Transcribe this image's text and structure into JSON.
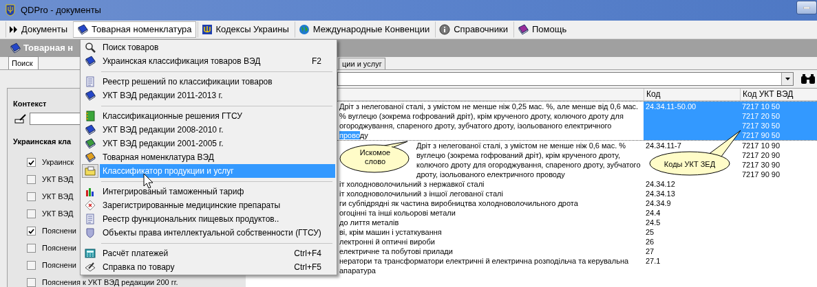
{
  "window": {
    "title": "QDPro - документы"
  },
  "menu_bar": [
    {
      "label": "Документы",
      "selected": false
    },
    {
      "label": "Товарная номенклатура",
      "selected": true
    },
    {
      "label": "Кодексы Украины",
      "selected": false
    },
    {
      "label": "Международные Конвенции",
      "selected": false
    },
    {
      "label": "Справочники",
      "selected": false
    },
    {
      "label": "Помощь",
      "selected": false
    }
  ],
  "section_header": "Товарная н",
  "tabs": [
    {
      "label": "Поиск",
      "selected": true
    },
    {
      "label": "ции и услуг",
      "selected": false
    }
  ],
  "search_panel": {
    "context_label": "Контекст",
    "group_label": "Украинская кла",
    "sources": [
      {
        "label": "Украинск",
        "checked": true
      },
      {
        "label": "УКТ ВЭД",
        "checked": false
      },
      {
        "label": "УКТ ВЭД",
        "checked": false
      },
      {
        "label": "УКТ ВЭД",
        "checked": false
      },
      {
        "label": "Пояснени",
        "checked": true
      },
      {
        "label": "Пояснени",
        "checked": false
      },
      {
        "label": "Пояснени",
        "checked": false
      },
      {
        "label": "Пояснения к УКТ ВЭД редакции 200 гг.",
        "checked": false
      }
    ]
  },
  "dropdown_menu": [
    {
      "kind": "item",
      "label": "Поиск товаров",
      "selected": false
    },
    {
      "kind": "item",
      "label": "Украинская классификация товаров ВЭД",
      "shortcut": "F2",
      "selected": false
    },
    {
      "kind": "separator"
    },
    {
      "kind": "item",
      "label": "Реестр решений по классификации товаров",
      "selected": false
    },
    {
      "kind": "item",
      "label": "УКТ ВЭД редакции 2011-2013 г.",
      "selected": false
    },
    {
      "kind": "separator"
    },
    {
      "kind": "item",
      "label": "Классификационные решения ГТСУ",
      "selected": false
    },
    {
      "kind": "item",
      "label": "УКТ ВЭД редакции 2008-2010 г.",
      "selected": false
    },
    {
      "kind": "item",
      "label": "УКТ ВЭД редакции 2001-2005 г.",
      "selected": false
    },
    {
      "kind": "item",
      "label": "Товарная номенклатура ВЭД",
      "selected": false
    },
    {
      "kind": "item",
      "label": "Классификатор продукции и услуг",
      "selected": true
    },
    {
      "kind": "separator"
    },
    {
      "kind": "item",
      "label": "Интегрированый таможенный тариф",
      "selected": false
    },
    {
      "kind": "item",
      "label": "Зарегистрированные медицинские препараты",
      "selected": false
    },
    {
      "kind": "item",
      "label": "Реестр функциональних пищевых продуктов..",
      "selected": false
    },
    {
      "kind": "item",
      "label": "Объекты права интеллектуальной собственности (ГТСУ)",
      "selected": false
    },
    {
      "kind": "separator"
    },
    {
      "kind": "item",
      "label": "Расчёт платежей",
      "shortcut": "Ctrl+F4",
      "selected": false
    },
    {
      "kind": "item",
      "label": "Справка по товару",
      "shortcut": "Ctrl+F5",
      "selected": false
    }
  ],
  "table": {
    "columns": [
      "Код",
      "Код УКТ ВЭД"
    ],
    "rows": [
      {
        "text_before": "Дріт з нелегованої сталі, з умістом не менше ніж 0,25 мас. %, але менше від 0,6 мас. % вуглецю (зокрема гофрований дріт), крім крученого дроту, колючого дроту для огороджування, спареного дроту, зубчатого дроту, ізольованого електричного ",
        "match": "прово",
        "text_after": "ду",
        "code": "24.34.11-50.00",
        "ukt_codes": [
          "7217 10 50",
          "7217 20 50",
          "7217 30 50",
          "7217 90 50"
        ],
        "selected": true
      },
      {
        "description": "Дріт з нелегованої сталі, з умістом не менше ніж 0,6 мас. % вуглецю (зокрема гофрований дріт), крім крученого дроту, колючого дроту для огороджування, спареного дроту, зубчатого дроту, ізольованого електричного проводу",
        "code": "24.34.11-7",
        "ukt_codes": [
          "7217 10 90",
          "7217 20 90",
          "7217 30 90",
          "7217 90 90"
        ],
        "selected": false
      },
      {
        "description": "іт холодноволочильний з нержавкої сталі",
        "code": "24.34.12",
        "selected": false
      },
      {
        "description": "іт холодноволочильний з іншої легованої сталі",
        "code": "24.34.13",
        "selected": false
      },
      {
        "description": "ги субпідрядні як частина виробництва холодноволочильного дрота",
        "code": "24.34.9",
        "selected": false
      },
      {
        "description": "огоцінні та інші кольорові метали",
        "code": "24.4",
        "selected": false
      },
      {
        "description": "до лиття металів",
        "code": "24.5",
        "selected": false
      },
      {
        "description": "ві, крім машин і устаткування",
        "code": "25",
        "selected": false
      },
      {
        "description": "лектронні й оптичні вироби",
        "code": "26",
        "selected": false
      },
      {
        "description": "електричне та побутові прилади",
        "code": "27",
        "selected": false
      },
      {
        "description": "нератори та трансформатори електричні й електрична розподільча та керувальна апаратура",
        "code": "27.1",
        "selected": false
      }
    ]
  },
  "callouts": [
    {
      "text": "Искомое слово"
    },
    {
      "text": "Коды УКТ ЗЕД"
    }
  ]
}
